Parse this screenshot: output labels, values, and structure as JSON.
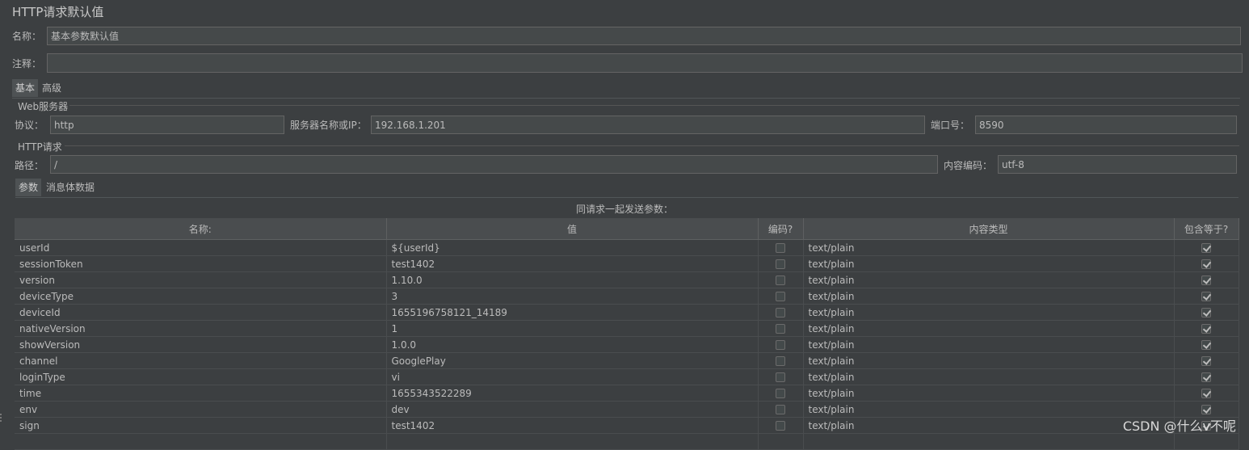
{
  "panel": {
    "title": "HTTP请求默认值",
    "name_label": "名称：",
    "name_value": "基本参数默认值",
    "comment_label": "注释：",
    "comment_value": ""
  },
  "tabs_top": [
    {
      "label": "基本",
      "active": true
    },
    {
      "label": "高级",
      "active": false
    }
  ],
  "web_server": {
    "group_title": "Web服务器",
    "protocol_label": "协议：",
    "protocol_value": "http",
    "server_label": "服务器名称或IP：",
    "server_value": "192.168.1.201",
    "port_label": "端口号：",
    "port_value": "8590"
  },
  "http_request": {
    "group_title": "HTTP请求",
    "path_label": "路径：",
    "path_value": "/",
    "encoding_label": "内容编码：",
    "encoding_value": "utf-8"
  },
  "tabs_params": [
    {
      "label": "参数",
      "active": true
    },
    {
      "label": "消息体数据",
      "active": false
    }
  ],
  "params": {
    "caption": "同请求一起发送参数：",
    "columns": [
      "名称:",
      "值",
      "编码?",
      "内容类型",
      "包含等于?"
    ],
    "rows": [
      {
        "name": "userId",
        "value": "${userId}",
        "encode": false,
        "type": "text/plain",
        "include_equals": true
      },
      {
        "name": "sessionToken",
        "value": "test1402",
        "encode": false,
        "type": "text/plain",
        "include_equals": true
      },
      {
        "name": "version",
        "value": "1.10.0",
        "encode": false,
        "type": "text/plain",
        "include_equals": true
      },
      {
        "name": "deviceType",
        "value": "3",
        "encode": false,
        "type": "text/plain",
        "include_equals": true
      },
      {
        "name": "deviceId",
        "value": "1655196758121_14189",
        "encode": false,
        "type": "text/plain",
        "include_equals": true
      },
      {
        "name": "nativeVersion",
        "value": "1",
        "encode": false,
        "type": "text/plain",
        "include_equals": true
      },
      {
        "name": "showVersion",
        "value": "1.0.0",
        "encode": false,
        "type": "text/plain",
        "include_equals": true
      },
      {
        "name": "channel",
        "value": "GooglePlay",
        "encode": false,
        "type": "text/plain",
        "include_equals": true
      },
      {
        "name": "loginType",
        "value": "vi",
        "encode": false,
        "type": "text/plain",
        "include_equals": true
      },
      {
        "name": "time",
        "value": "1655343522289",
        "encode": false,
        "type": "text/plain",
        "include_equals": true
      },
      {
        "name": "env",
        "value": "dev",
        "encode": false,
        "type": "text/plain",
        "include_equals": true
      },
      {
        "name": "sign",
        "value": "test1402",
        "encode": false,
        "type": "text/plain",
        "include_equals": true
      }
    ]
  },
  "watermark": "CSDN @什么v不呢"
}
